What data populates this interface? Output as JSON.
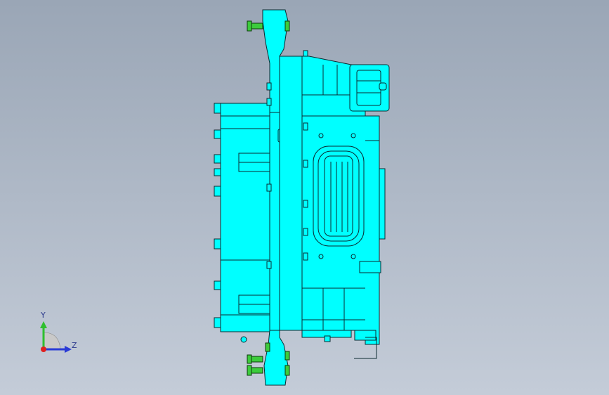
{
  "triad": {
    "y_label": "Y",
    "z_label": "Z"
  },
  "part": {
    "body_color": "#00ffff",
    "edge_color": "#0b2a30",
    "bolt_color": "#3ccc3c",
    "background_top": "#9aa6b6",
    "background_bottom": "#c4ccd8"
  }
}
